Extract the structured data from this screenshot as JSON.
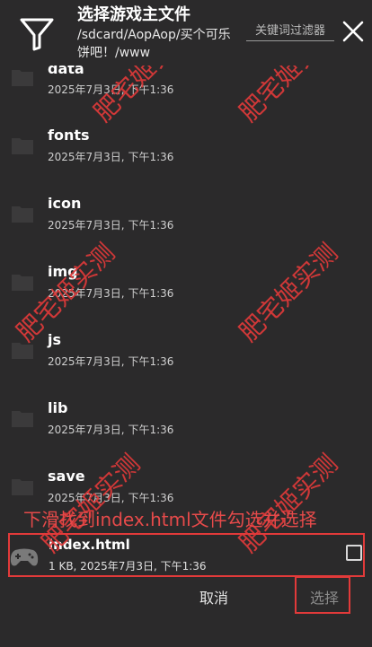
{
  "header": {
    "title": "选择游戏主文件",
    "path": "/sdcard/AopAop/买个可乐饼吧！/www",
    "filter_placeholder": "关键词过滤器"
  },
  "folders": [
    {
      "name": "data",
      "date": "2025年7月3日, 下午1:36"
    },
    {
      "name": "fonts",
      "date": "2025年7月3日, 下午1:36"
    },
    {
      "name": "icon",
      "date": "2025年7月3日, 下午1:36"
    },
    {
      "name": "img",
      "date": "2025年7月3日, 下午1:36"
    },
    {
      "name": "js",
      "date": "2025年7月3日, 下午1:36"
    },
    {
      "name": "lib",
      "date": "2025年7月3日, 下午1:36"
    },
    {
      "name": "save",
      "date": "2025年7月3日, 下午1:36"
    }
  ],
  "file": {
    "name": "index.html",
    "meta": "1 KB, 2025年7月3日, 下午1:36",
    "checked": false
  },
  "hint": "下滑找到index.html文件勾选并选择",
  "watermark": "肥宅姬实测",
  "actions": {
    "cancel": "取消",
    "select": "选择"
  },
  "colors": {
    "background": "#2b2a2b",
    "highlight": "#e23a3a",
    "watermark": "#e23a3a"
  }
}
